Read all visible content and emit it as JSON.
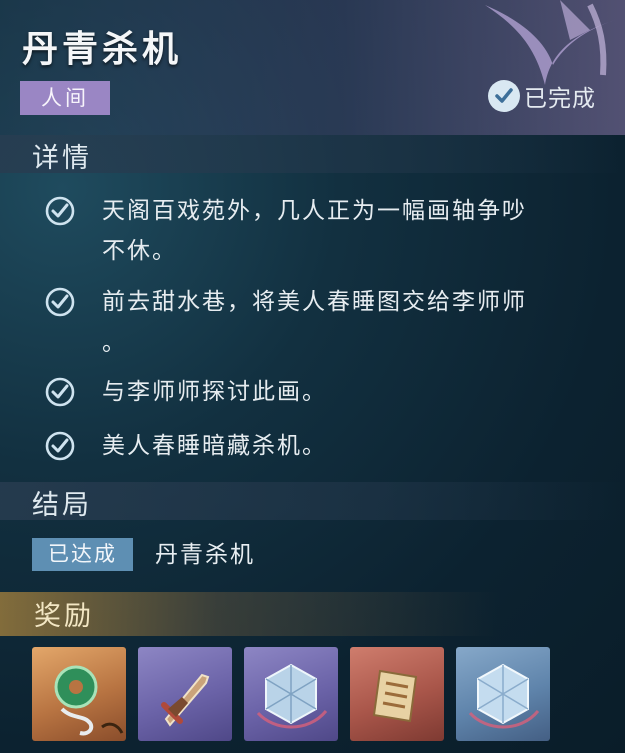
{
  "quest": {
    "title": "丹青杀机",
    "category": "人间",
    "status": "已完成"
  },
  "details": {
    "heading": "详情",
    "items": [
      {
        "line1": "天阁百戏苑外，几人正为一幅画轴争吵",
        "line2": "不休。",
        "completed": true
      },
      {
        "line1": "前去甜水巷，将美人春睡图交给李师师",
        "line2": "。",
        "completed": true
      },
      {
        "line1": "与李师师探讨此画。",
        "line2": "",
        "completed": true
      },
      {
        "line1": "美人春睡暗藏杀机。",
        "line2": "",
        "completed": true
      }
    ]
  },
  "ending": {
    "heading": "结局",
    "badge": "已达成",
    "name": "丹青杀机"
  },
  "rewards": {
    "heading": "奖励",
    "items": [
      {
        "icon": "jade-pendant-icon",
        "rarity_color": "#c27d48"
      },
      {
        "icon": "dagger-icon",
        "rarity_color": "#6b63a8"
      },
      {
        "icon": "crystal-cube-icon",
        "rarity_color": "#6b63a8"
      },
      {
        "icon": "scroll-icon",
        "rarity_color": "#a9564a"
      },
      {
        "icon": "crystal-cube-icon",
        "rarity_color": "#5f84ab"
      }
    ]
  },
  "colors": {
    "accent_world_tag": "#9a86c4",
    "ending_badge": "#5e8fb3",
    "check": "#cfe3ef"
  }
}
